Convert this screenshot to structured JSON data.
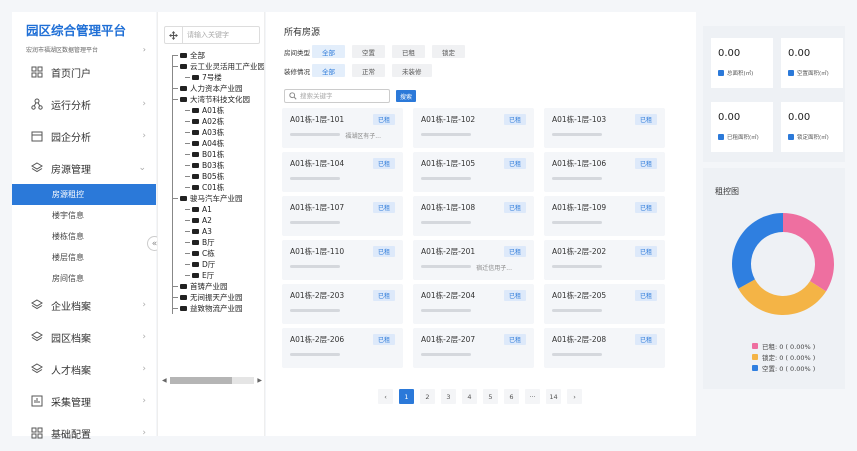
{
  "sidebar": {
    "title": "园区综合管理平台",
    "subtitle": "宏润市福湖区数据管理平台",
    "menu": [
      {
        "label": "首页门户",
        "icon": "grid-icon"
      },
      {
        "label": "运行分析",
        "icon": "network-icon"
      },
      {
        "label": "园企分析",
        "icon": "calendar-icon"
      },
      {
        "label": "房源管理",
        "icon": "layers-icon",
        "expanded": true
      },
      {
        "label": "企业档案",
        "icon": "layers-icon"
      },
      {
        "label": "园区档案",
        "icon": "layers-icon"
      },
      {
        "label": "人才档案",
        "icon": "layers-icon"
      },
      {
        "label": "采集管理",
        "icon": "chart-icon"
      },
      {
        "label": "基础配置",
        "icon": "grid-icon"
      }
    ],
    "submenu": [
      "房源租控",
      "楼宇信息",
      "楼栋信息",
      "楼层信息",
      "房间信息"
    ],
    "active_submenu": "房源租控"
  },
  "tree": {
    "search_placeholder": "请输入关键字",
    "nodes": [
      {
        "label": "全部",
        "level": 0
      },
      {
        "label": "云工业灵活用工产业园",
        "level": 0
      },
      {
        "label": "7号楼",
        "level": 1
      },
      {
        "label": "人力资本产业园",
        "level": 0
      },
      {
        "label": "大湾节科技文化园",
        "level": 0
      },
      {
        "label": "A01栋",
        "level": 1
      },
      {
        "label": "A02栋",
        "level": 1
      },
      {
        "label": "A03栋",
        "level": 1
      },
      {
        "label": "A04栋",
        "level": 1
      },
      {
        "label": "B01栋",
        "level": 1
      },
      {
        "label": "B03栋",
        "level": 1
      },
      {
        "label": "B05栋",
        "level": 1
      },
      {
        "label": "C01栋",
        "level": 1
      },
      {
        "label": "骏马汽车产业园",
        "level": 0
      },
      {
        "label": "A1",
        "level": 1
      },
      {
        "label": "A2",
        "level": 1
      },
      {
        "label": "A3",
        "level": 1
      },
      {
        "label": "B厅",
        "level": 1
      },
      {
        "label": "C栋",
        "level": 1
      },
      {
        "label": "D厅",
        "level": 1
      },
      {
        "label": "E厅",
        "level": 1
      },
      {
        "label": "首铸产业园",
        "level": 0
      },
      {
        "label": "无间振天产业园",
        "level": 0
      },
      {
        "label": "益致物流产业园",
        "level": 0
      }
    ]
  },
  "main": {
    "title": "所有房源",
    "filters": [
      {
        "label": "房间类型",
        "options": [
          "全部",
          "空置",
          "已租",
          "锁定"
        ],
        "selected": "全部"
      },
      {
        "label": "装修情况",
        "options": [
          "全部",
          "正常",
          "未装修"
        ],
        "selected": "全部"
      }
    ],
    "search_placeholder": "搜索关键字",
    "search_button": "搜索",
    "rooms": [
      {
        "code": "A01栋-1层-101",
        "status": "已租",
        "tenant": "福湖区有子..."
      },
      {
        "code": "A01栋-1层-102",
        "status": "已租",
        "tenant": ""
      },
      {
        "code": "A01栋-1层-103",
        "status": "已租",
        "tenant": ""
      },
      {
        "code": "A01栋-1层-104",
        "status": "已租",
        "tenant": ""
      },
      {
        "code": "A01栋-1层-105",
        "status": "已租",
        "tenant": ""
      },
      {
        "code": "A01栋-1层-106",
        "status": "已租",
        "tenant": ""
      },
      {
        "code": "A01栋-1层-107",
        "status": "已租",
        "tenant": ""
      },
      {
        "code": "A01栋-1层-108",
        "status": "已租",
        "tenant": ""
      },
      {
        "code": "A01栋-1层-109",
        "status": "已租",
        "tenant": ""
      },
      {
        "code": "A01栋-1层-110",
        "status": "已租",
        "tenant": ""
      },
      {
        "code": "A01栋-2层-201",
        "status": "已租",
        "tenant": "宿迁信用子..."
      },
      {
        "code": "A01栋-2层-202",
        "status": "已租",
        "tenant": ""
      },
      {
        "code": "A01栋-2层-203",
        "status": "已租",
        "tenant": ""
      },
      {
        "code": "A01栋-2层-204",
        "status": "已租",
        "tenant": ""
      },
      {
        "code": "A01栋-2层-205",
        "status": "已租",
        "tenant": ""
      },
      {
        "code": "A01栋-2层-206",
        "status": "已租",
        "tenant": ""
      },
      {
        "code": "A01栋-2层-207",
        "status": "已租",
        "tenant": ""
      },
      {
        "code": "A01栋-2层-208",
        "status": "已租",
        "tenant": ""
      }
    ],
    "pagination": {
      "prev": "‹",
      "pages": [
        "1",
        "2",
        "3",
        "4",
        "5",
        "6",
        "···",
        "14"
      ],
      "current": "1",
      "next": "›"
    }
  },
  "stats": [
    {
      "value": "0.00",
      "label": "总面积(㎡)"
    },
    {
      "value": "0.00",
      "label": "空置面积(㎡)"
    },
    {
      "value": "0.00",
      "label": "已租面积(㎡)"
    },
    {
      "value": "0.00",
      "label": "锁定面积(㎡)"
    }
  ],
  "chart_data": {
    "type": "pie",
    "title": "租控图",
    "categories": [
      "已租",
      "锁定",
      "空置"
    ],
    "values": [
      0,
      0,
      0
    ],
    "display_share": [
      0.34,
      0.33,
      0.33
    ],
    "legend": [
      "已租: 0 ( 0.00% )",
      "锁定: 0 ( 0.00% )",
      "空置: 0 ( 0.00% )"
    ],
    "colors": [
      "#ee6fa0",
      "#f4b446",
      "#2f7fe0"
    ],
    "legend_position": "bottom"
  },
  "colors": {
    "accent": "#2b79d9",
    "sidebar_active": "#2b79d9"
  }
}
